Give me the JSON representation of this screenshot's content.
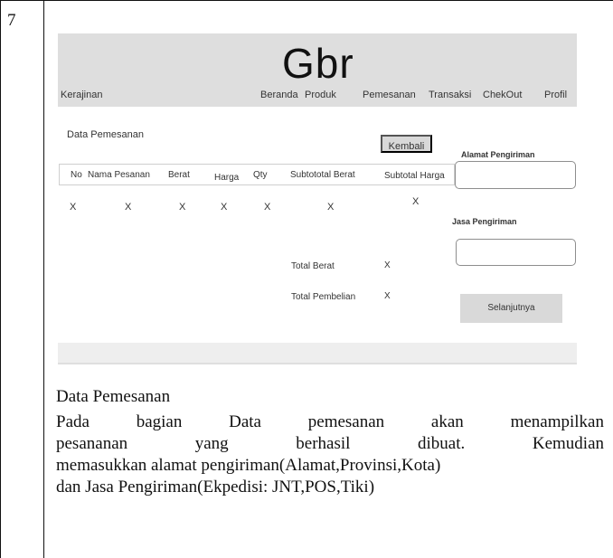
{
  "row_number": "7",
  "mockup": {
    "logo": "Gbr",
    "brand": "Kerajinan",
    "nav": [
      "Beranda",
      "Produk",
      "Pemesanan",
      "Transaksi",
      "ChekOut",
      "Profil"
    ],
    "section_title": "Data Pemesanan",
    "back_button": "Kembali",
    "table": {
      "headers": [
        "No",
        "Nama Pesanan",
        "Berat",
        "Harga",
        "Qty",
        "Subtototal Berat",
        "Subtotal Harga"
      ],
      "row": [
        "X",
        "X",
        "X",
        "X",
        "X",
        "X",
        "X"
      ]
    },
    "totals": {
      "berat_label": "Total Berat",
      "berat_value": "X",
      "pembelian_label": "Total Pembelian",
      "pembelian_value": "X"
    },
    "shipping": {
      "address_label": "Alamat Pengiriman",
      "address_value": "",
      "service_label": "Jasa Pengiriman",
      "service_value": ""
    },
    "next_button": "Selanjutnya"
  },
  "description": {
    "title": "Data Pemesanan",
    "lines": [
      "Pada bagian Data pemesanan akan menampilkan",
      "pesananan yang berhasil dibuat. Kemudian",
      "memasukkan alamat pengiriman(Alamat,Provinsi,Kota)",
      "dan Jasa Pengiriman(Ekpedisi: JNT,POS,Tiki)"
    ]
  }
}
